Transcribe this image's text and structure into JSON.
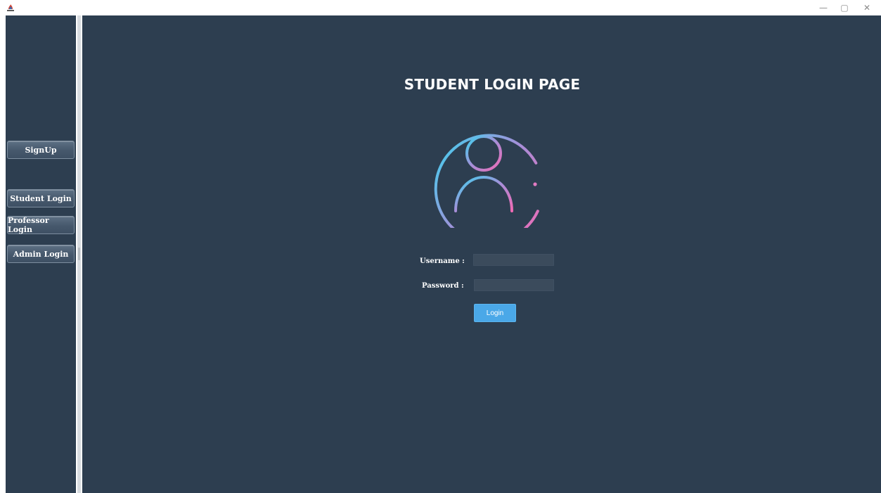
{
  "window": {
    "icon": "java-app-icon",
    "controls": {
      "minimize": "—",
      "maximize": "▢",
      "close": "✕"
    }
  },
  "sidebar": {
    "items": [
      {
        "label": "SignUp"
      },
      {
        "label": "Student Login"
      },
      {
        "label": "Professor Login"
      },
      {
        "label": "Admin Login"
      }
    ]
  },
  "main": {
    "title": "STUDENT LOGIN PAGE",
    "avatar_icon": "user-avatar-icon",
    "form": {
      "username_label": "Username :",
      "username_value": "",
      "password_label": "Password :",
      "password_value": "",
      "login_label": "Login"
    }
  },
  "colors": {
    "background": "#2d3e50",
    "accent": "#4aa8e8",
    "avatar_gradient_start": "#3ad4f0",
    "avatar_gradient_mid": "#a68ed8",
    "avatar_gradient_end": "#f06ab4"
  }
}
